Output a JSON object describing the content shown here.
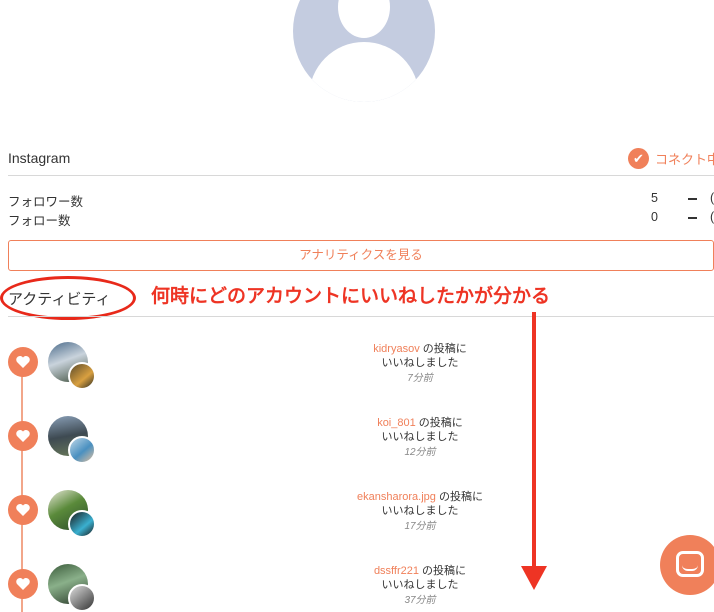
{
  "instagram": {
    "title": "Instagram",
    "connect_label": "コネクト中",
    "stats": [
      {
        "label": "フォロワー数",
        "value": "5"
      },
      {
        "label": "フォロー数",
        "value": "0"
      }
    ],
    "analytics_button": "アナリティクスを見る"
  },
  "activity": {
    "title": "アクティビティ",
    "annotation": "何時にどのアカウントにいいねしたかが分かる",
    "items": [
      {
        "user": "kidryasov",
        "suffix": " の投稿に",
        "line2": "いいねしました",
        "time": "7分前"
      },
      {
        "user": "koi_801",
        "suffix": " の投稿に",
        "line2": "いいねしました",
        "time": "12分前"
      },
      {
        "user": "ekansharora.jpg",
        "suffix": " の投稿に",
        "line2": "いいねしました",
        "time": "17分前"
      },
      {
        "user": "dssffr221",
        "suffix": " の投稿に",
        "line2": "いいねしました",
        "time": "37分前"
      }
    ]
  },
  "colors": {
    "accent": "#f0805a",
    "annotation": "#ee3424",
    "avatar_placeholder": "#c4cce0"
  },
  "icons": [
    "user-placeholder-icon",
    "check-icon",
    "heart-icon",
    "chat-icon"
  ]
}
